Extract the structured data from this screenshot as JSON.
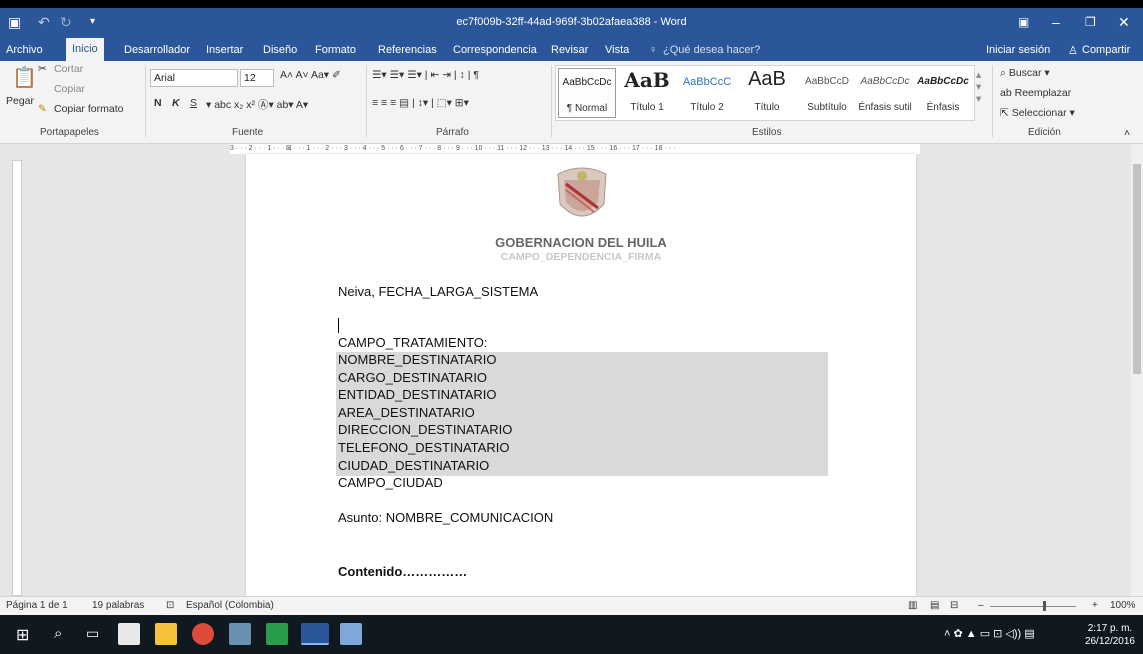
{
  "window": {
    "title": "ec7f009b-32ff-44ad-969f-3b02afaea388 - Word",
    "restore_icon": "ribbon-display-options-icon"
  },
  "tabs": [
    "Archivo",
    "Inicio",
    "Desarrollador",
    "Insertar",
    "Diseño",
    "Formato",
    "Referencias",
    "Correspondencia",
    "Revisar",
    "Vista"
  ],
  "tell_me": "¿Qué desea hacer?",
  "account": {
    "signin": "Iniciar sesión",
    "share": "Compartir"
  },
  "clipboard": {
    "paste": "Pegar",
    "cut": "Cortar",
    "copy": "Copiar",
    "format_painter": "Copiar formato",
    "label": "Portapapeles"
  },
  "font": {
    "name": "Arial",
    "size": "12",
    "label": "Fuente",
    "bold": "N",
    "italic": "K",
    "underline": "S"
  },
  "paragraph": {
    "label": "Párrafo"
  },
  "styles": {
    "label": "Estilos",
    "items": [
      {
        "preview": "AaBbCcDc",
        "name": "¶ Normal"
      },
      {
        "preview": "AaB",
        "name": "Título 1"
      },
      {
        "preview": "AaBbCcC",
        "name": "Título 2"
      },
      {
        "preview": "AaB",
        "name": "Título"
      },
      {
        "preview": "AaBbCcD",
        "name": "Subtítulo"
      },
      {
        "preview": "AaBbCcDc",
        "name": "Énfasis sutil"
      },
      {
        "preview": "AaBbCcDc",
        "name": "Énfasis"
      }
    ]
  },
  "editing": {
    "label": "Edición",
    "find": "Buscar",
    "replace": "Reemplazar",
    "select": "Seleccionar"
  },
  "ruler_text": "3 · · · 2 · · · 1 · · · ⊠ · · · 1 · · · 2 · · · 3 · · · 4 · · · 5 · · · 6 · · · 7 · · · 8 · · · 9 · · · 10 · · · 11 · · · 12 · · · 13 · · · 14 · · · 15 · · · 16 · · · 17 · · · 18 · · ·",
  "document": {
    "header_title": "GOBERNACION DEL HUILA",
    "header_sub": "CAMPO_DEPENDENCIA_FIRMA",
    "date_line": "Neiva, FECHA_LARGA_SISTEMA",
    "treatment": "CAMPO_TRATAMIENTO:",
    "recipient_lines": [
      "NOMBRE_DESTINATARIO",
      "CARGO_DESTINATARIO",
      "ENTIDAD_DESTINATARIO",
      "AREA_DESTINATARIO",
      "DIRECCION_DESTINATARIO",
      "TELEFONO_DESTINATARIO",
      "CIUDAD_DESTINATARIO"
    ],
    "city": "CAMPO_CIUDAD",
    "subject": "Asunto: NOMBRE_COMUNICACION",
    "content": "Contenido……………"
  },
  "status": {
    "page": "Página 1 de 1",
    "words": "19 palabras",
    "language": "Español (Colombia)",
    "zoom": "100%"
  },
  "clock": {
    "time": "2:17 p. m.",
    "date": "26/12/2016"
  },
  "colors": {
    "accent": "#2b579a",
    "taskbar": "#101820"
  }
}
